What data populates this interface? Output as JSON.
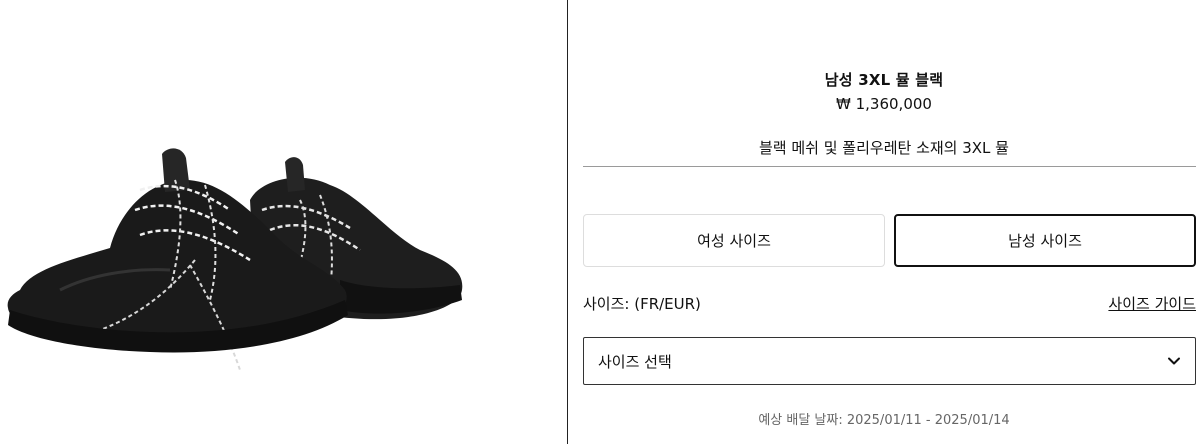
{
  "product": {
    "title": "남성 3XL 뮬 블랙",
    "price": "₩ 1,360,000",
    "description": "블랙 메쉬 및 폴리우레탄 소재의 3XL 뮬"
  },
  "size_tabs": {
    "women_label": "여성 사이즈",
    "men_label": "남성 사이즈",
    "selected": "men"
  },
  "size": {
    "label": "사이즈: (FR/EUR)",
    "guide_link": "사이즈 가이드",
    "select_placeholder": "사이즈 선택"
  },
  "delivery": {
    "text": "예상 배달 날짜: 2025/01/11 - 2025/01/14"
  },
  "icons": {
    "select_chevron": "chevron-down-icon"
  },
  "colors": {
    "shoe": "#1a1a1a",
    "divider": "#9a9a9a",
    "muted_text": "#666666"
  }
}
